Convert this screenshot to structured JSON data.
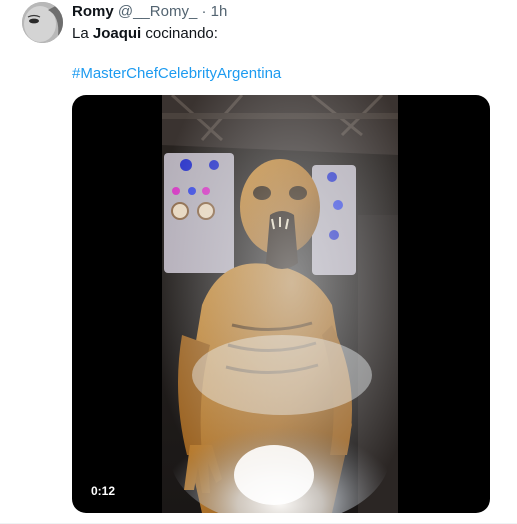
{
  "tweet": {
    "author_name": "Romy",
    "author_handle": "@__Romy_",
    "separator": "·",
    "time": "1h",
    "text_before": "La ",
    "text_bold": "Joaqui",
    "text_after": " cocinando:",
    "hashtag": "#MasterChefCelebrityArgentina",
    "video_duration": "0:12"
  },
  "colors": {
    "link": "#1d9bf0",
    "secondary_text": "#536471",
    "primary_text": "#0f1419"
  }
}
